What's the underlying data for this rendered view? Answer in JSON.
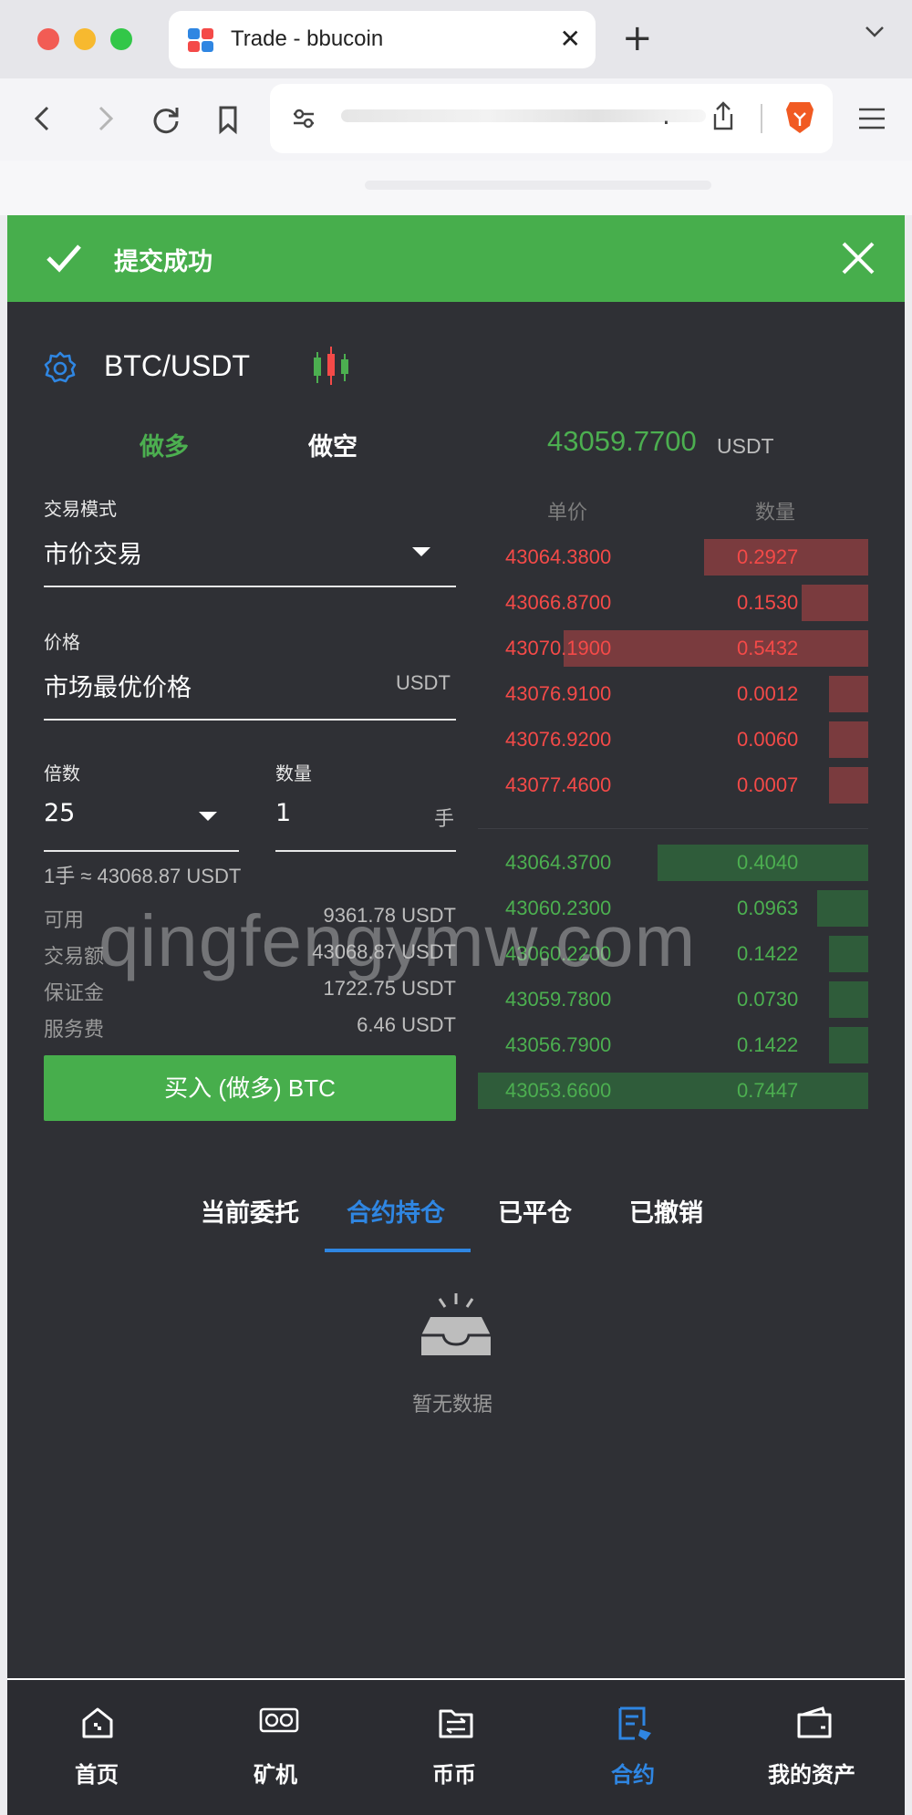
{
  "browser": {
    "tab_title": "Trade - bbucoin",
    "url_tail": "."
  },
  "toast": {
    "message": "提交成功"
  },
  "market": {
    "pair": "BTC/USDT"
  },
  "direction_tabs": {
    "long": "做多",
    "short": "做空"
  },
  "form": {
    "mode_label": "交易模式",
    "mode_value": "市价交易",
    "price_label": "价格",
    "price_value": "市场最优价格",
    "price_unit": "USDT",
    "leverage_label": "倍数",
    "leverage_value": "25",
    "qty_label": "数量",
    "qty_value": "1",
    "qty_unit": "手",
    "lot_note": "1手 ≈ 43068.87 USDT"
  },
  "summary": [
    {
      "key": "可用",
      "value": "9361.78 USDT"
    },
    {
      "key": "交易额",
      "value": "43068.87 USDT"
    },
    {
      "key": "保证金",
      "value": "1722.75 USDT"
    },
    {
      "key": "服务费",
      "value": "6.46 USDT"
    }
  ],
  "buy_button": "买入 (做多) BTC",
  "orderbook": {
    "last_price": "43059.7700",
    "last_unit": "USDT",
    "head_price": "单价",
    "head_qty": "数量",
    "asks": [
      {
        "price": "43064.3800",
        "qty": "0.2927",
        "depth": 0.42
      },
      {
        "price": "43066.8700",
        "qty": "0.1530",
        "depth": 0.17
      },
      {
        "price": "43070.1900",
        "qty": "0.5432",
        "depth": 0.78
      },
      {
        "price": "43076.9100",
        "qty": "0.0012",
        "depth": 0.1
      },
      {
        "price": "43076.9200",
        "qty": "0.0060",
        "depth": 0.1
      },
      {
        "price": "43077.4600",
        "qty": "0.0007",
        "depth": 0.1
      }
    ],
    "bids": [
      {
        "price": "43064.3700",
        "qty": "0.4040",
        "depth": 0.54
      },
      {
        "price": "43060.2300",
        "qty": "0.0963",
        "depth": 0.13
      },
      {
        "price": "43060.2200",
        "qty": "0.1422",
        "depth": 0.1
      },
      {
        "price": "43059.7800",
        "qty": "0.0730",
        "depth": 0.1
      },
      {
        "price": "43056.7900",
        "qty": "0.1422",
        "depth": 0.1
      },
      {
        "price": "43053.6600",
        "qty": "0.7447",
        "depth": 1.0
      }
    ]
  },
  "order_tabs": [
    "当前委托",
    "合约持仓",
    "已平仓",
    "已撤销"
  ],
  "active_order_tab": 1,
  "empty_text": "暂无数据",
  "watermark": "qingfengymw.com",
  "bottom_nav": [
    {
      "label": "首页",
      "icon": "home-icon"
    },
    {
      "label": "矿机",
      "icon": "miner-icon"
    },
    {
      "label": "币币",
      "icon": "exchange-icon"
    },
    {
      "label": "合约",
      "icon": "contract-icon"
    },
    {
      "label": "我的资产",
      "icon": "wallet-icon"
    }
  ],
  "active_nav": 3,
  "colors": {
    "buy": "#47ae4c",
    "sell": "#f44a48",
    "accent": "#2f86e2",
    "bg": "#2f3035"
  }
}
